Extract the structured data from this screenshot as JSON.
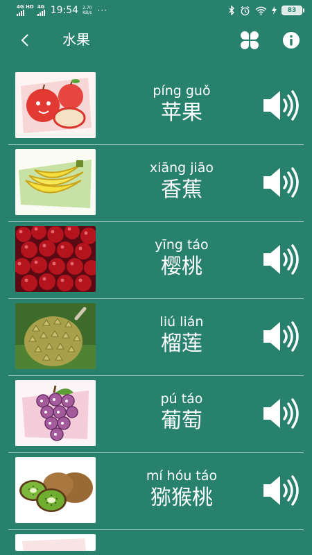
{
  "status_bar": {
    "network1": "4G HD",
    "network2": "4G",
    "time": "19:54",
    "speed_value": "2.70",
    "speed_unit": "KB/s",
    "more": "···",
    "battery": "83"
  },
  "app_bar": {
    "title": "水果",
    "back_icon": "chevron-left-icon",
    "menu_icon": "four-petal-grid-icon",
    "info_icon": "info-icon"
  },
  "colors": {
    "background": "#27816c",
    "text": "#ffffff"
  },
  "fruits": [
    {
      "pinyin": "píng guǒ",
      "name": "苹果",
      "image": "apple-illustration"
    },
    {
      "pinyin": "xiāng jiāo",
      "name": "香蕉",
      "image": "banana-illustration"
    },
    {
      "pinyin": "yīng táo",
      "name": "樱桃",
      "image": "cherry-photo"
    },
    {
      "pinyin": "liú lián",
      "name": "榴莲",
      "image": "durian-photo"
    },
    {
      "pinyin": "pú táo",
      "name": "葡萄",
      "image": "grape-illustration"
    },
    {
      "pinyin": "mí hóu táo",
      "name": "猕猴桃",
      "image": "kiwi-photo"
    }
  ]
}
